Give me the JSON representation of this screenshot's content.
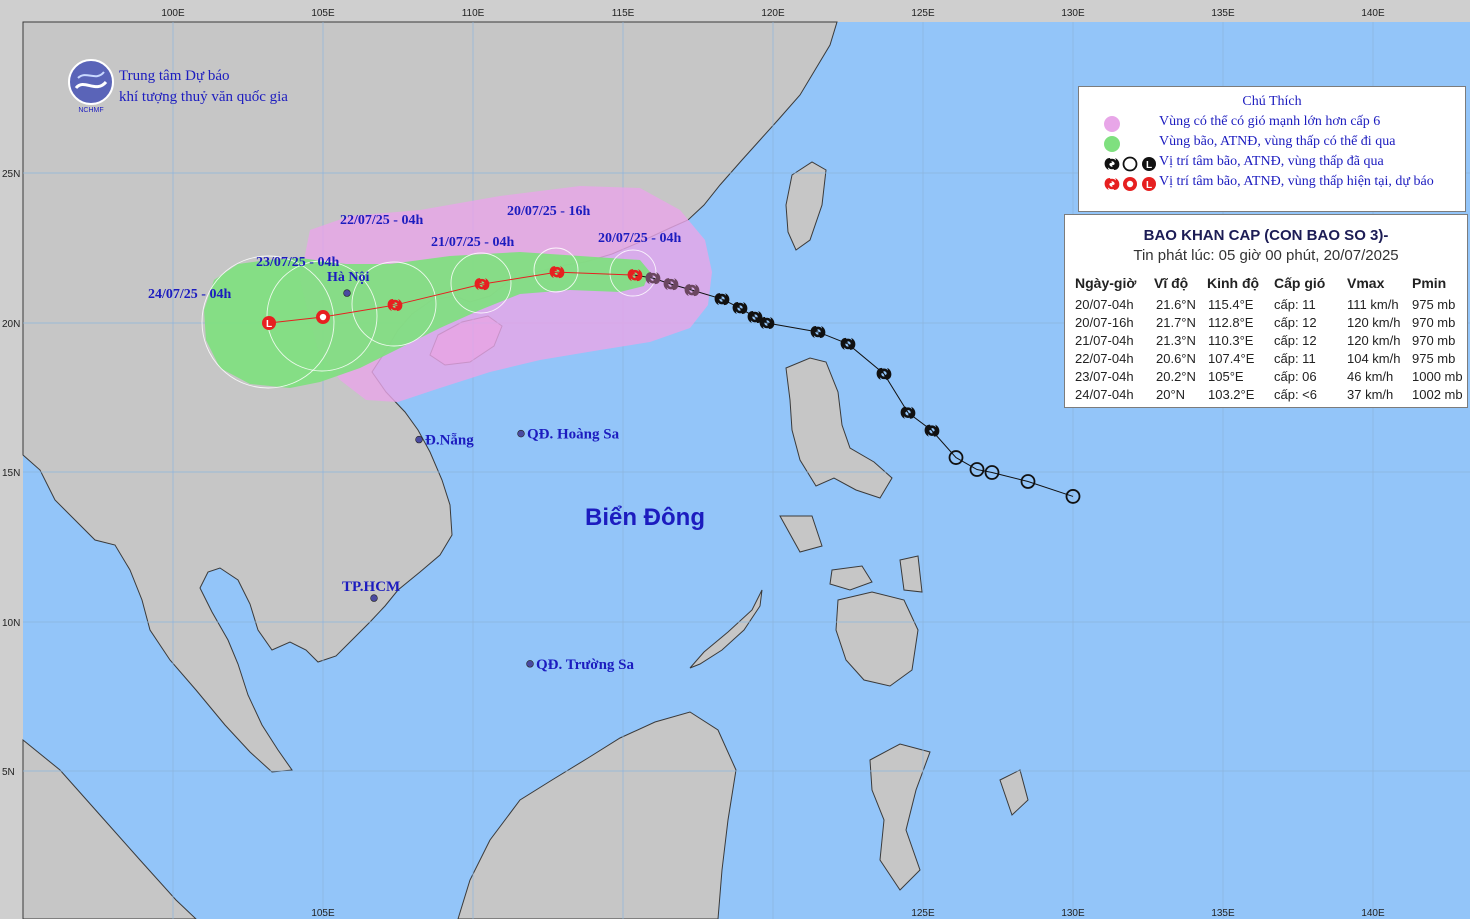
{
  "agency": {
    "line1": "Trung tâm Dự báo",
    "line2": "khí tượng thuỷ văn quốc gia",
    "logo_text": "NCHMF"
  },
  "axes": {
    "lon_top": [
      "100E",
      "105E",
      "110E",
      "115E",
      "120E",
      "125E",
      "130E",
      "135E",
      "140E"
    ],
    "lon_bottom": [
      "105E",
      "125E",
      "130E",
      "135E",
      "140E"
    ],
    "lat": [
      "25N",
      "20N",
      "15N",
      "10N",
      "5N"
    ]
  },
  "places": [
    {
      "name": "Hà Nội",
      "lon": 105.8,
      "lat": 21.0
    },
    {
      "name": "Đ.Nẵng",
      "lon": 108.2,
      "lat": 16.1
    },
    {
      "name": "QĐ. Hoàng Sa",
      "lon": 111.6,
      "lat": 16.3
    },
    {
      "name": "TP.HCM",
      "lon": 106.7,
      "lat": 10.8
    },
    {
      "name": "QĐ. Trường Sa",
      "lon": 111.9,
      "lat": 8.6
    }
  ],
  "sea_label": "Biển Đông",
  "forecast_labels": [
    "20/07/25 - 04h",
    "20/07/25 - 16h",
    "21/07/25 - 04h",
    "22/07/25 - 04h",
    "23/07/25 - 04h",
    "24/07/25 - 04h"
  ],
  "legend": {
    "title": "Chú Thích",
    "items": [
      "Vùng có thể có gió mạnh lớn hơn cấp 6",
      "Vùng bão, ATNĐ, vùng thấp có thể đi qua",
      "Vị trí tâm bão, ATNĐ, vùng thấp đã qua",
      "Vị trí tâm bão, ATNĐ, vùng thấp hiện tại, dự báo"
    ],
    "colors": {
      "strong_wind": "#e8a6e8",
      "storm_zone": "#7fe07f",
      "past": "#111111",
      "current": "#e62020"
    }
  },
  "bulletin": {
    "title": "BAO KHAN CAP (CON BAO SO 3)-",
    "issued": "Tin phát lúc: 05 giờ 00 phút, 20/07/2025",
    "headers": [
      "Ngày-giờ",
      "Vĩ độ",
      "Kinh độ",
      "Cấp gió",
      "Vmax",
      "Pmin"
    ],
    "rows": [
      [
        "20/07-04h",
        "21.6°N",
        "115.4°E",
        "cấp: 11",
        "111 km/h",
        "975 mb"
      ],
      [
        "20/07-16h",
        "21.7°N",
        "112.8°E",
        "cấp: 12",
        "120 km/h",
        "970 mb"
      ],
      [
        "21/07-04h",
        "21.3°N",
        "110.3°E",
        "cấp: 12",
        "120 km/h",
        "970 mb"
      ],
      [
        "22/07-04h",
        "20.6°N",
        "107.4°E",
        "cấp: 11",
        "104 km/h",
        "975 mb"
      ],
      [
        "23/07-04h",
        "20.2°N",
        "105°E",
        "cấp: 06",
        "46 km/h",
        "1000 mb"
      ],
      [
        "24/07-04h",
        "20°N",
        "103.2°E",
        "cấp: <6",
        "37 km/h",
        "1002 mb"
      ]
    ]
  },
  "track": {
    "past": [
      {
        "lon": 130.0,
        "lat": 14.2,
        "kind": "low"
      },
      {
        "lon": 128.5,
        "lat": 14.7,
        "kind": "low"
      },
      {
        "lon": 127.3,
        "lat": 15.0,
        "kind": "low"
      },
      {
        "lon": 126.8,
        "lat": 15.1,
        "kind": "low"
      },
      {
        "lon": 126.1,
        "lat": 15.5,
        "kind": "low"
      },
      {
        "lon": 125.3,
        "lat": 16.4,
        "kind": "storm"
      },
      {
        "lon": 124.5,
        "lat": 17.0,
        "kind": "storm"
      },
      {
        "lon": 123.7,
        "lat": 18.3,
        "kind": "storm"
      },
      {
        "lon": 122.5,
        "lat": 19.3,
        "kind": "storm"
      },
      {
        "lon": 121.5,
        "lat": 19.7,
        "kind": "storm"
      },
      {
        "lon": 119.8,
        "lat": 20.0,
        "kind": "storm"
      },
      {
        "lon": 119.4,
        "lat": 20.2,
        "kind": "storm"
      },
      {
        "lon": 118.9,
        "lat": 20.5,
        "kind": "storm"
      },
      {
        "lon": 118.3,
        "lat": 20.8,
        "kind": "storm"
      },
      {
        "lon": 117.3,
        "lat": 21.1,
        "kind": "storm-faded"
      },
      {
        "lon": 116.6,
        "lat": 21.3,
        "kind": "storm-faded"
      },
      {
        "lon": 116.0,
        "lat": 21.5,
        "kind": "storm-faded"
      }
    ],
    "forecast": [
      {
        "lon": 115.4,
        "lat": 21.6,
        "kind": "storm"
      },
      {
        "lon": 112.8,
        "lat": 21.7,
        "kind": "storm"
      },
      {
        "lon": 110.3,
        "lat": 21.3,
        "kind": "storm"
      },
      {
        "lon": 107.4,
        "lat": 20.6,
        "kind": "storm"
      },
      {
        "lon": 105.0,
        "lat": 20.2,
        "kind": "depression"
      },
      {
        "lon": 103.2,
        "lat": 20.0,
        "kind": "low"
      }
    ]
  }
}
